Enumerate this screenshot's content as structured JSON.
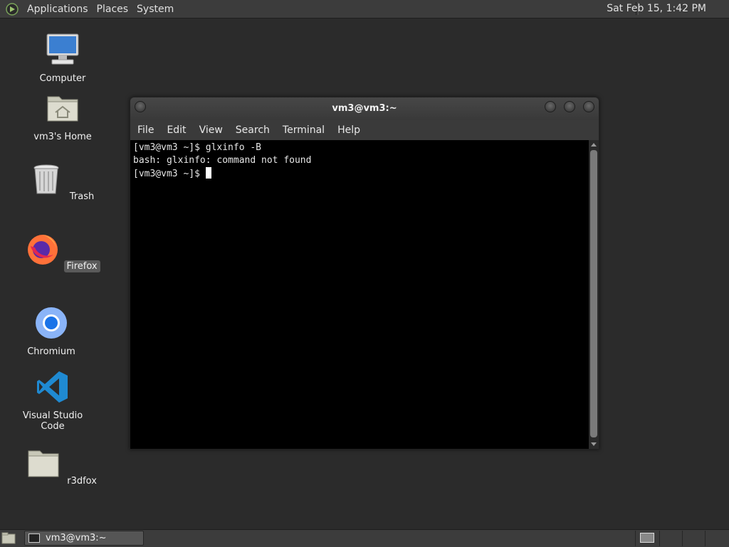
{
  "top_panel": {
    "menus": [
      "Applications",
      "Places",
      "System"
    ],
    "clock": "Sat Feb 15,  1:42 PM"
  },
  "desktop": {
    "icons": [
      {
        "label": "Computer",
        "icon": "computer-icon"
      },
      {
        "label": "vm3's Home",
        "icon": "home-folder-icon"
      },
      {
        "label": "Trash",
        "icon": "trash-icon"
      },
      {
        "label": "Firefox",
        "icon": "firefox-icon",
        "selected": true
      },
      {
        "label": "Chromium",
        "icon": "chromium-icon"
      },
      {
        "label": "Visual Studio Code",
        "icon": "vscode-icon"
      },
      {
        "label": "r3dfox",
        "icon": "folder-icon"
      }
    ]
  },
  "terminal": {
    "title": "vm3@vm3:~",
    "menus": [
      "File",
      "Edit",
      "View",
      "Search",
      "Terminal",
      "Help"
    ],
    "lines": [
      "[vm3@vm3 ~]$ glxinfo -B",
      "bash: glxinfo: command not found",
      "[vm3@vm3 ~]$ "
    ]
  },
  "taskbar": {
    "tasks": [
      {
        "label": "vm3@vm3:~"
      }
    ]
  }
}
